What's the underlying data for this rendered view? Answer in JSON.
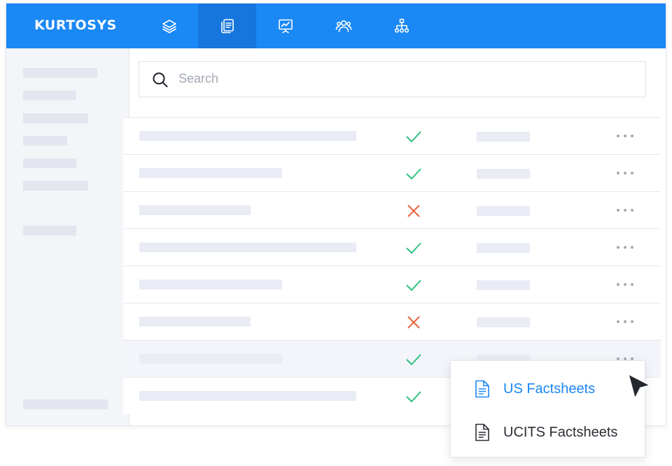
{
  "brand": {
    "name": "KURTOSYS",
    "color": "#1a88f5",
    "active_color": "#1676dd"
  },
  "nav": {
    "items": [
      {
        "icon": "layers-icon"
      },
      {
        "icon": "documents-icon",
        "active": true
      },
      {
        "icon": "presentation-icon"
      },
      {
        "icon": "users-icon"
      },
      {
        "icon": "hierarchy-icon"
      }
    ]
  },
  "search": {
    "placeholder": "Search",
    "value": ""
  },
  "table": {
    "rows": [
      {
        "status": "check"
      },
      {
        "status": "check"
      },
      {
        "status": "cross"
      },
      {
        "status": "check"
      },
      {
        "status": "check"
      },
      {
        "status": "cross"
      },
      {
        "status": "check",
        "hovered": true
      },
      {
        "status": "check"
      }
    ]
  },
  "dropdown": {
    "items": [
      {
        "label": "US Factsheets",
        "icon": "document-icon",
        "highlighted": true
      },
      {
        "label": "UCITS Factsheets",
        "icon": "document-icon"
      }
    ]
  },
  "colors": {
    "check": "#2ec27e",
    "cross": "#e8643c",
    "highlight": "#1a88f5",
    "text": "#2b2f36"
  }
}
